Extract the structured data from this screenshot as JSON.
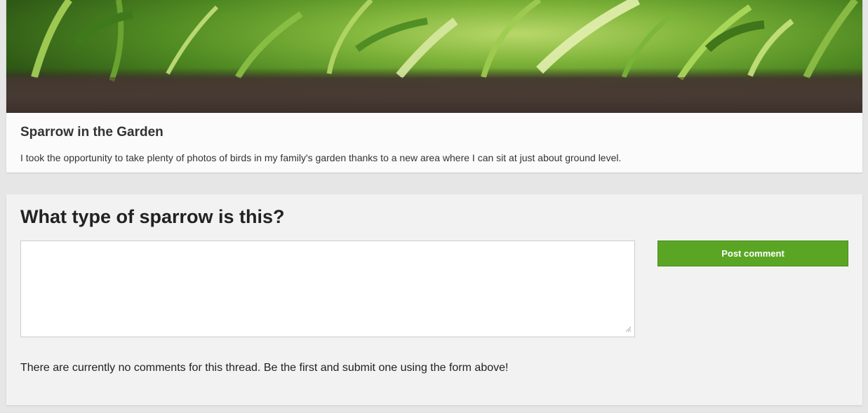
{
  "photo": {
    "image_name": "garden-grass-photo",
    "title": "Sparrow in the Garden",
    "description": "I took the opportunity to take plenty of photos of birds in my family's garden thanks to a new area where I can sit at just about ground level."
  },
  "comments": {
    "heading": "What type of sparrow is this?",
    "input_value": "",
    "post_button_label": "Post comment",
    "empty_message": "There are currently no comments for this thread. Be the first and submit one using the form above!"
  },
  "colors": {
    "background": "#e6e6e6",
    "card_background": "#f2f2f2",
    "accent_green": "#5aa624",
    "text": "#333333"
  }
}
